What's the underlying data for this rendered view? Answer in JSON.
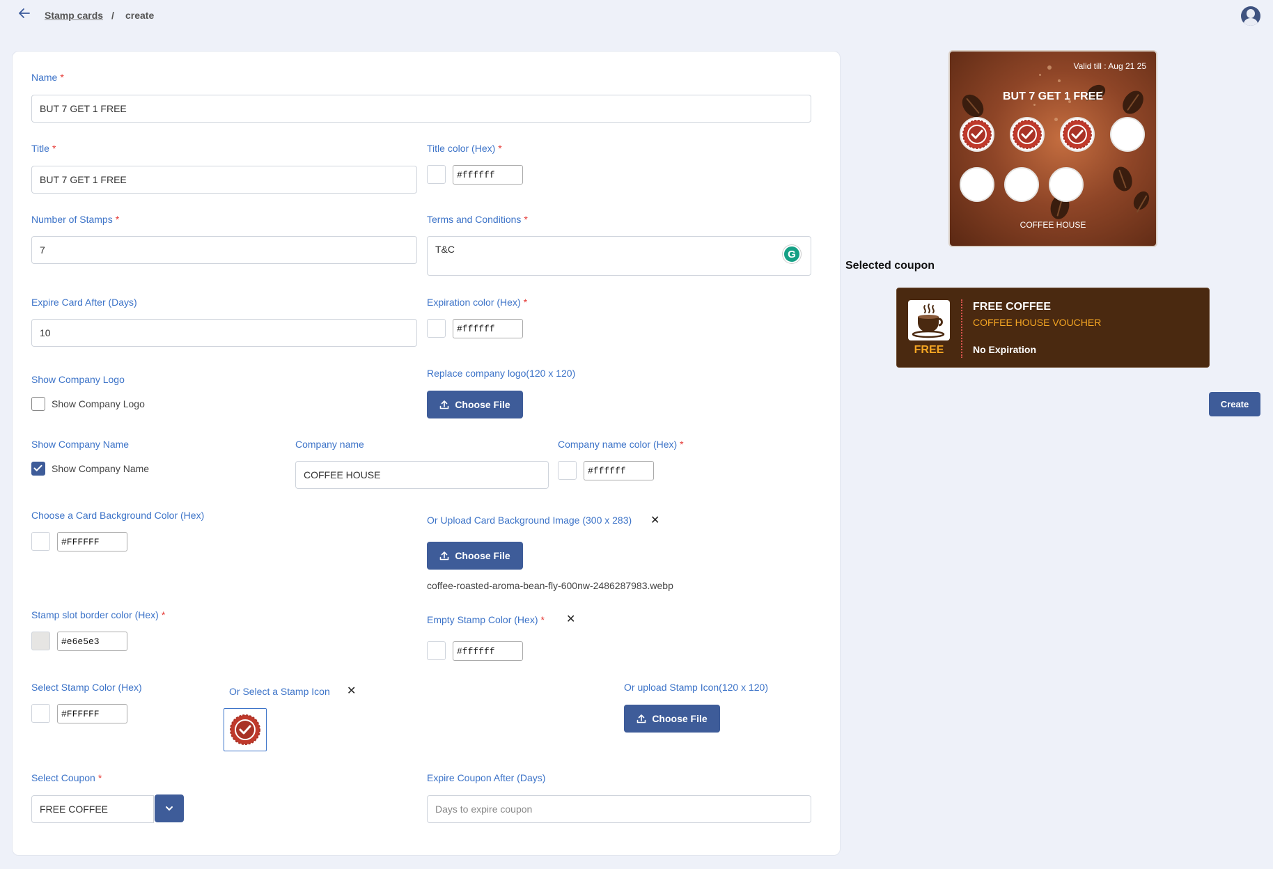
{
  "breadcrumb": {
    "parent": "Stamp cards",
    "separator": "/",
    "current": "create"
  },
  "form": {
    "name": {
      "label": "Name",
      "required": "*",
      "value": "BUT 7 GET 1 FREE"
    },
    "title": {
      "label": "Title",
      "required": "*",
      "value": "BUT 7 GET 1 FREE"
    },
    "title_color": {
      "label": "Title color (Hex)",
      "required": "*",
      "value": "#ffffff"
    },
    "num_stamps": {
      "label": "Number of Stamps",
      "required": "*",
      "value": "7"
    },
    "terms": {
      "label": "Terms and Conditions",
      "required": "*",
      "value": "T&C"
    },
    "expire_days": {
      "label": "Expire Card After (Days)",
      "value": "10"
    },
    "expiration_color": {
      "label": "Expiration color (Hex)",
      "required": "*",
      "value": "#ffffff"
    },
    "show_logo": {
      "label": "Show Company Logo",
      "checkbox_label": "Show Company Logo",
      "checked": false
    },
    "replace_logo": {
      "label": "Replace company logo(120 x 120)",
      "button": "Choose File"
    },
    "show_name": {
      "label": "Show Company Name",
      "checkbox_label": "Show Company Name",
      "checked": true
    },
    "company_name": {
      "label": "Company name",
      "value": "COFFEE HOUSE"
    },
    "company_name_color": {
      "label": "Company name color (Hex)",
      "required": "*",
      "value": "#ffffff"
    },
    "bg_color": {
      "label": "Choose a Card Background Color (Hex)",
      "value": "#FFFFFF"
    },
    "bg_image": {
      "label": "Or Upload Card Background Image (300 x 283)",
      "button": "Choose File",
      "filename": "coffee-roasted-aroma-bean-fly-600nw-2486287983.webp"
    },
    "slot_border": {
      "label": "Stamp slot border color (Hex)",
      "required": "*",
      "value": "#e6e5e3"
    },
    "empty_stamp": {
      "label": "Empty Stamp Color (Hex)",
      "required": "*",
      "value": "#ffffff"
    },
    "stamp_color": {
      "label": "Select Stamp Color (Hex)",
      "value": "#FFFFFF"
    },
    "stamp_icon": {
      "label": "Or Select a Stamp Icon"
    },
    "upload_stamp": {
      "label": "Or upload Stamp Icon(120 x 120)",
      "button": "Choose File"
    },
    "coupon": {
      "label": "Select Coupon",
      "required": "*",
      "value": "FREE COFFEE"
    },
    "coupon_expire": {
      "label": "Expire Coupon After (Days)",
      "placeholder": "Days to expire coupon"
    }
  },
  "preview": {
    "valid_till": "Valid till : Aug 21 25",
    "title": "BUT 7 GET 1 FREE",
    "company_name": "COFFEE HOUSE",
    "stamps_total": 7,
    "stamps_filled": 3
  },
  "selected_coupon": {
    "heading": "Selected coupon",
    "title": "FREE COFFEE",
    "subtitle": "COFFEE HOUSE VOUCHER",
    "badge": "FREE",
    "expiration": "No Expiration"
  },
  "actions": {
    "create": "Create"
  },
  "colors": {
    "primary": "#3e5c99",
    "label": "#3c73c8",
    "required": "#e53935",
    "coupon_bg": "#4a2910",
    "coupon_accent": "#f5a623"
  }
}
